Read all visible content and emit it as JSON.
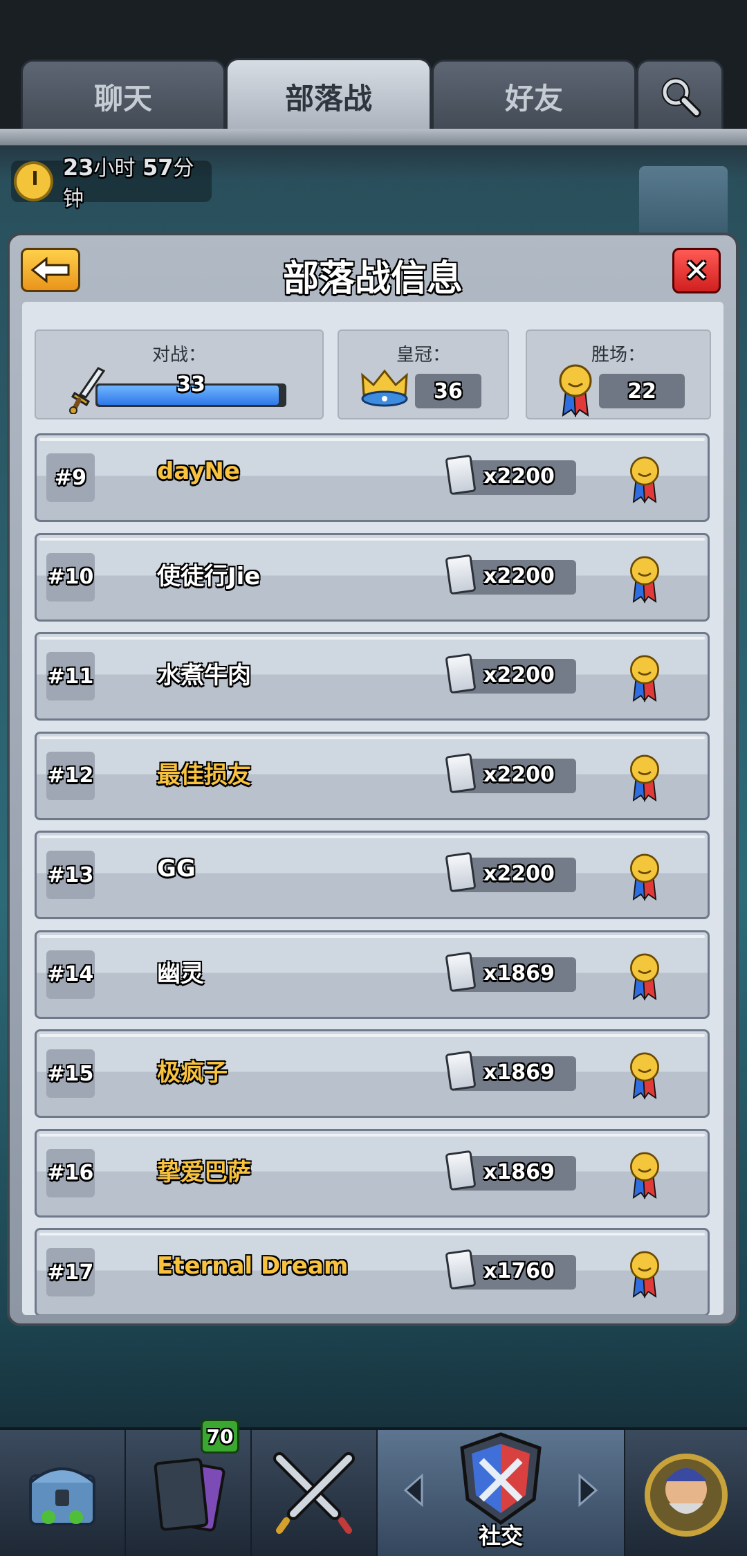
{
  "tabs": [
    {
      "label": "聊天",
      "active": false
    },
    {
      "label": "部落战",
      "active": true
    },
    {
      "label": "好友",
      "active": false
    }
  ],
  "timer": {
    "hours": "23",
    "hours_unit": "小时",
    "minutes": "57",
    "minutes_unit": "分钟"
  },
  "panel": {
    "title": "部落战信息",
    "stats": {
      "battles": {
        "label": "对战：",
        "value": "33",
        "progress": 0.97
      },
      "crowns": {
        "label": "皇冠：",
        "value": "36"
      },
      "wins": {
        "label": "胜场：",
        "value": "22"
      }
    },
    "rows": [
      {
        "rank": "#9",
        "name": "dayNe",
        "gold": true,
        "cards": "x2200"
      },
      {
        "rank": "#10",
        "name": "使徒行Jie",
        "gold": false,
        "cards": "x2200"
      },
      {
        "rank": "#11",
        "name": "水煮牛肉",
        "gold": false,
        "cards": "x2200"
      },
      {
        "rank": "#12",
        "name": "最佳损友",
        "gold": true,
        "cards": "x2200"
      },
      {
        "rank": "#13",
        "name": "GG",
        "gold": false,
        "cards": "x2200"
      },
      {
        "rank": "#14",
        "name": "幽灵",
        "gold": false,
        "cards": "x1869"
      },
      {
        "rank": "#15",
        "name": "极疯子",
        "gold": true,
        "cards": "x1869"
      },
      {
        "rank": "#16",
        "name": "挚爱巴萨",
        "gold": true,
        "cards": "x1869"
      },
      {
        "rank": "#17",
        "name": "Eternal Dream",
        "gold": true,
        "cards": "x1760"
      }
    ]
  },
  "nav": {
    "cards_badge": "70",
    "social_label": "社交"
  },
  "colors": {
    "gold_name": "#f8c23e",
    "bar_fill": "#2f77e8",
    "close": "#d0201f",
    "back": "#f0a826"
  }
}
